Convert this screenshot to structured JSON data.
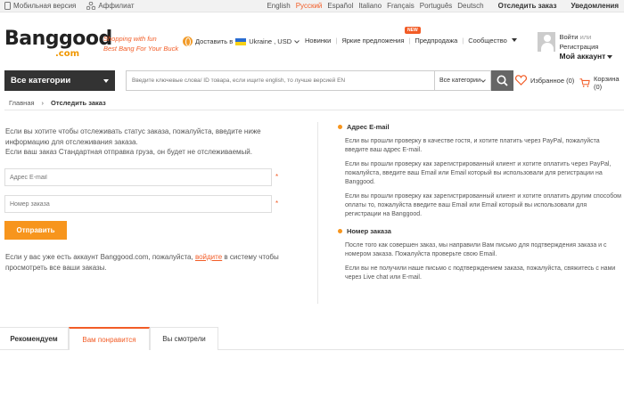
{
  "topbar": {
    "mobile": "Мобильная версия",
    "affiliate": "Аффилиат",
    "languages": [
      "English",
      "Русский",
      "Español",
      "Italiano",
      "Français",
      "Português",
      "Deutsch"
    ],
    "active_language": "Русский",
    "track_order": "Отследить заказ",
    "notice": "Уведомления"
  },
  "header": {
    "logo_main": "Banggood",
    "logo_sub": ".com",
    "tagline_line1": "Shopping with fun",
    "tagline_line2": "Best Bang For Your Buck",
    "ship_to_label": "Доставить в",
    "ship_to_value": "Ukraine , USD",
    "nav": [
      "Новинки",
      "Яркие предложения",
      "Предпродажа",
      "Сообщество"
    ],
    "new_badge": "NEW",
    "login": "Войти",
    "or": "или",
    "register": "Регистрация",
    "my_account": "Мой аккаунт"
  },
  "search": {
    "categories_button": "Все категории",
    "placeholder": "Введите ключевые слова/ ID товара, если ищите english, то лучше версией EN",
    "scope": "Все категории",
    "favorites": "Избранное (0)",
    "cart": "Корзина (0)"
  },
  "breadcrumb": {
    "home": "Главная",
    "current": "Отследить заказ"
  },
  "form": {
    "intro_line1": "Если вы хотите чтобы отслеживать статус заказа, пожалуйста, введите ниже",
    "intro_line2": "информацию для отслеживания заказа.",
    "intro_line3": "Если ваш заказ Стандартная отправка груза, он будет не отслеживаемый.",
    "email_placeholder": "Адрес E-mail",
    "order_placeholder": "Номер заказа",
    "submit": "Отправить",
    "login_note_before": "Если у вас уже есть аккаунт Banggood.com, пожалуйста,",
    "login_link": "войдите",
    "login_note_after": "в систему чтобы просмотреть все ваши заказы."
  },
  "help": {
    "email_title": "Адрес E-mail",
    "email_p1": "Если вы прошли проверку в качестве гостя, и хотите платить через PayPal, пожалуйста введите ваш адрес E-mail.",
    "email_p2": "Если вы прошли проверку как зарегистрированный клиент и хотите оплатить через PayPal, пожалуйста, введите ваш Email или Email который вы использовали для регистрации на Banggood.",
    "email_p3": "Если вы прошли проверку как зарегистрированный клиент и хотите оплатить другим способом оплаты то, пожалуйста введите ваш Email или Email который вы использовали для регистрации на Banggood.",
    "order_title": "Номер заказа",
    "order_p1": "После того как совершен заказ, мы направили Вам письмо для подтверждения заказа и с номером заказа. Пожалуйста проверьте свою Email.",
    "order_p2": "Если вы не получили наше письмо с подтверждением заказа, пожалуйста, свяжитесь с нами через Live chat или E-mail."
  },
  "tabs": [
    "Рекомендуем",
    "Вам понравится",
    "Вы смотрели"
  ],
  "colors": {
    "accent": "#f25c26",
    "button": "#f7951d",
    "dark": "#333333"
  }
}
